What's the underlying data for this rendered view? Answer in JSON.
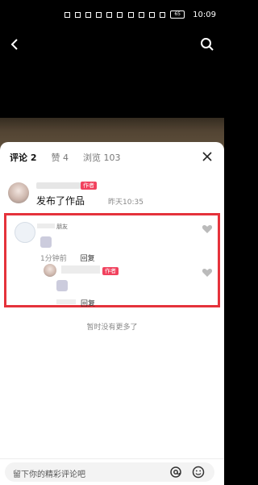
{
  "status_bar": {
    "battery": "65",
    "time": "10:09"
  },
  "tabs": [
    {
      "label": "评论 2"
    },
    {
      "label": "赞 4"
    },
    {
      "label": "浏览 103"
    }
  ],
  "comment_main": {
    "badge": "作者",
    "text": "发布了作品",
    "time": "昨天10:35"
  },
  "comment_friend": {
    "tag": "朋友",
    "time": "1分钟前",
    "reply_label": "回复"
  },
  "reply": {
    "badge": "作者",
    "reply_label": "回复"
  },
  "no_more_text": "暂时没有更多了",
  "input": {
    "placeholder": "留下你的精彩评论吧"
  },
  "icons": {
    "back": "back-arrow-icon",
    "search": "search-icon",
    "close": "close-icon",
    "heart": "heart-icon",
    "at": "at-icon",
    "emoji": "emoji-icon"
  },
  "colors": {
    "accent": "#f1425e",
    "highlight": "#e5323b"
  }
}
